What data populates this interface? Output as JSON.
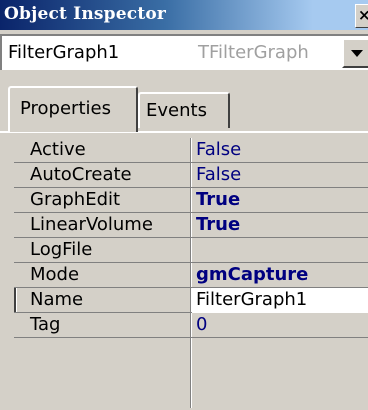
{
  "window": {
    "title": "Object Inspector",
    "close_glyph": "×"
  },
  "object_selector": {
    "name": "FilterGraph1",
    "type": "TFilterGraph",
    "dropdown_icon": "chevron-down-icon"
  },
  "tabs": [
    {
      "label": "Properties",
      "active": true
    },
    {
      "label": "Events",
      "active": false
    }
  ],
  "properties": [
    {
      "name": "Active",
      "value": "False",
      "bold": false
    },
    {
      "name": "AutoCreate",
      "value": "False",
      "bold": false
    },
    {
      "name": "GraphEdit",
      "value": "True",
      "bold": true
    },
    {
      "name": "LinearVolume",
      "value": "True",
      "bold": true
    },
    {
      "name": "LogFile",
      "value": "",
      "bold": false
    },
    {
      "name": "Mode",
      "value": "gmCapture",
      "bold": true
    },
    {
      "name": "Name",
      "value": "FilterGraph1",
      "bold": false,
      "selected": true
    },
    {
      "name": "Tag",
      "value": "0",
      "bold": false
    }
  ],
  "colors": {
    "titlebar_start": "#0a246a",
    "titlebar_end": "#a6caf0",
    "value_text": "#000080",
    "face": "#d4d0c8"
  }
}
